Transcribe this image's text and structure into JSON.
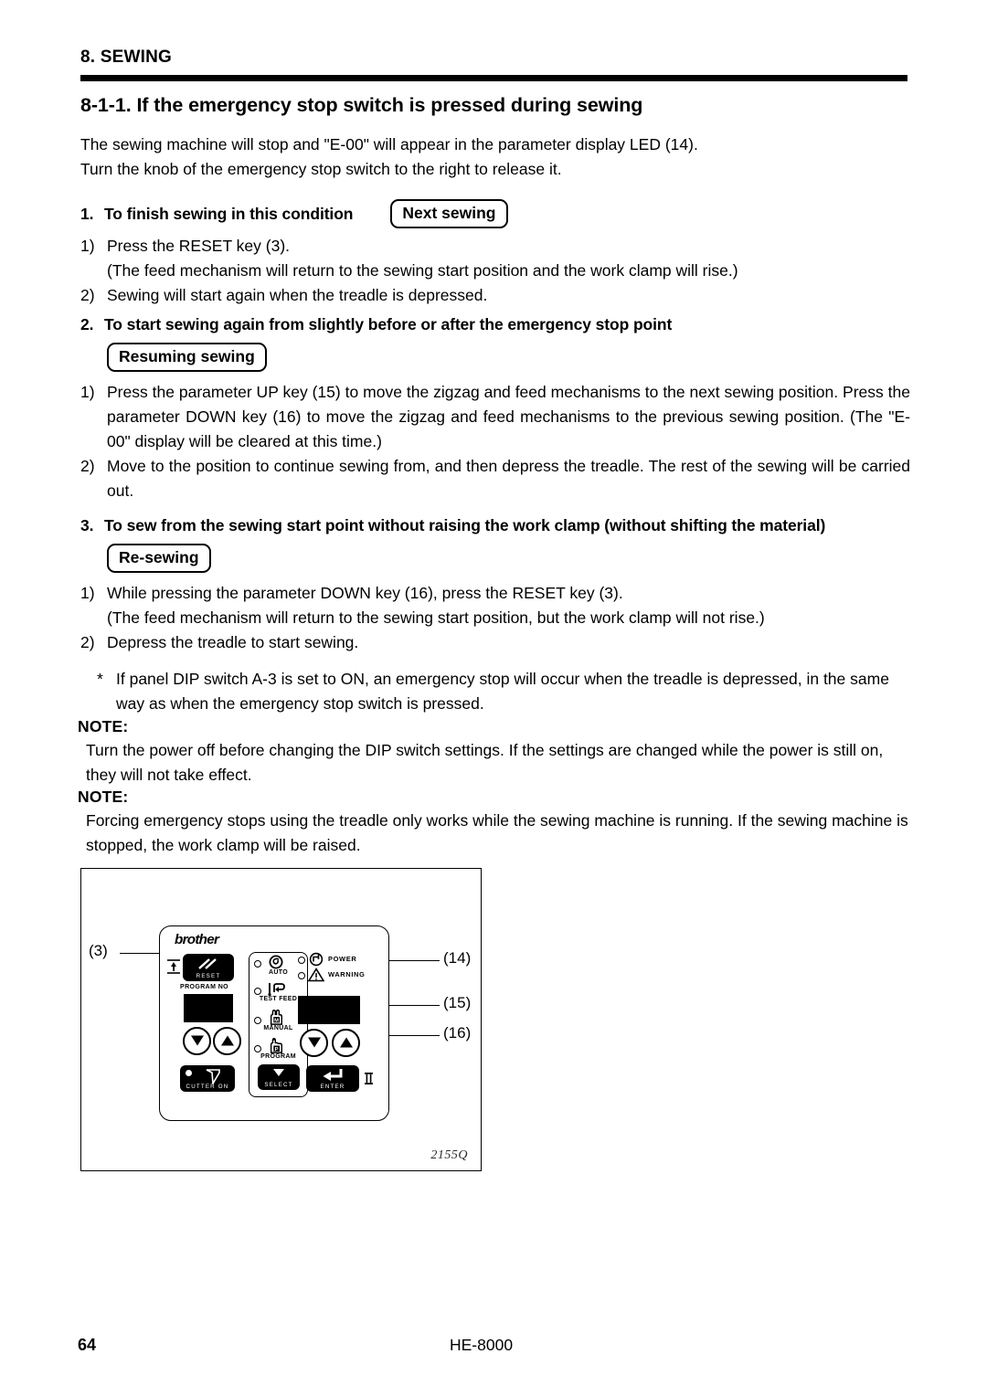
{
  "header": {
    "chapter": "8. SEWING",
    "section_title": "8-1-1. If the emergency stop switch is pressed during sewing"
  },
  "intro": {
    "line1": "The sewing machine will stop and \"E-00\" will appear in the parameter display LED (14).",
    "line2": "Turn the knob of the emergency stop switch to the right to release it."
  },
  "sections": [
    {
      "number": "1.",
      "heading": "To finish sewing in this condition",
      "box_label": "Next sewing",
      "items": [
        {
          "mark": "1)",
          "text": "Press the RESET key (3).",
          "cont": "(The feed mechanism will return to the sewing start position and the work clamp will rise.)"
        },
        {
          "mark": "2)",
          "text": "Sewing will start again when the treadle is depressed.",
          "cont": ""
        }
      ]
    },
    {
      "number": "2.",
      "heading": "To start sewing again from slightly before or after the emergency stop point",
      "box_label": "Resuming sewing",
      "items": [
        {
          "mark": "1)",
          "text": "Press the parameter UP key (15) to move the zigzag and feed mechanisms to the next sewing position. Press the parameter DOWN key (16) to move the zigzag and feed mechanisms to the previous sewing position. (The \"E-00\" display will be cleared at this time.)",
          "cont": ""
        },
        {
          "mark": "2)",
          "text": "Move to the position to continue sewing from, and then depress the treadle. The rest of the sewing will be carried out.",
          "cont": ""
        }
      ]
    },
    {
      "number": "3.",
      "heading": "To sew from the sewing start point without raising the work clamp (without shifting the material)",
      "box_label": "Re-sewing",
      "items": [
        {
          "mark": "1)",
          "text": "While pressing the parameter DOWN key (16), press the RESET key (3).",
          "cont": "(The feed mechanism will return to the sewing start position, but the work clamp will not rise.)"
        },
        {
          "mark": "2)",
          "text": "Depress the treadle to start sewing.",
          "cont": ""
        }
      ]
    }
  ],
  "asterisk_note": {
    "mark": "*",
    "text": "If panel DIP switch A-3 is set to ON, an emergency stop will occur when the treadle is depressed, in the same way as when the emergency stop switch is pressed."
  },
  "notes": [
    {
      "label": "NOTE:",
      "text": "Turn the power off before changing the DIP switch settings. If the settings are changed while the power is still on, they will not take effect."
    },
    {
      "label": "NOTE:",
      "text": "Forcing emergency stops using the treadle only works while the sewing machine is running. If the sewing machine is stopped, the work clamp will be raised."
    }
  ],
  "figure": {
    "id": "2155Q",
    "brand": "brother",
    "keys": {
      "reset": "RESET",
      "cutter": "CUTTER ON",
      "select": "SELECT",
      "enter": "ENTER"
    },
    "labels": {
      "program_no": "PROGRAM NO"
    },
    "modes": [
      {
        "name": "AUTO"
      },
      {
        "name": "TEST FEED"
      },
      {
        "name": "MANUAL",
        "glyph": "M"
      },
      {
        "name": "PROGRAM",
        "glyph": "P"
      }
    ],
    "indicators": [
      {
        "name": "POWER"
      },
      {
        "name": "WARNING"
      }
    ],
    "callouts": [
      {
        "id": "(3)"
      },
      {
        "id": "(14)"
      },
      {
        "id": "(15)"
      },
      {
        "id": "(16)"
      }
    ]
  },
  "footer": {
    "page_number": "64",
    "model": "HE-8000"
  }
}
